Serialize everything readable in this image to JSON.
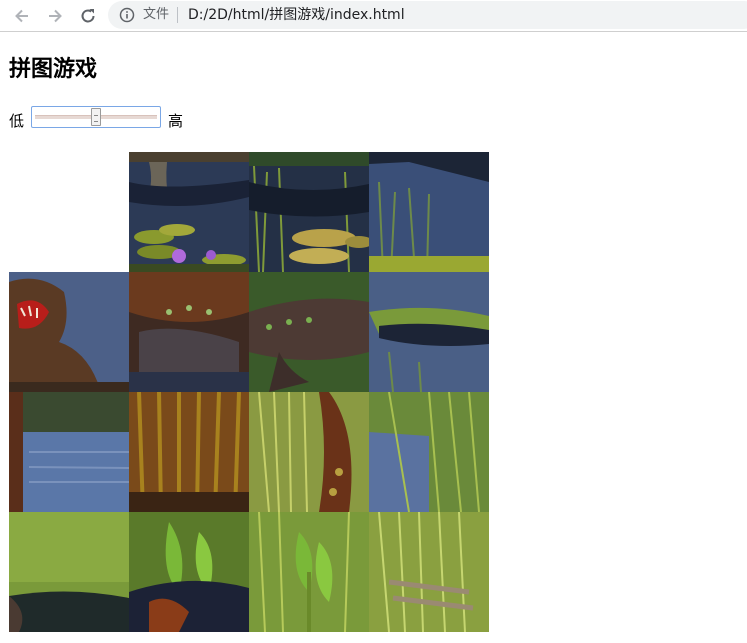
{
  "browser": {
    "scheme_label": "文件",
    "url": "D:/2D/html/拼图游戏/index.html"
  },
  "page": {
    "title": "拼图游戏"
  },
  "difficulty": {
    "low_label": "低",
    "high_label": "高",
    "value": 0.5
  },
  "puzzle": {
    "rows": 4,
    "cols": 4,
    "empty_cell": [
      0,
      0
    ]
  }
}
